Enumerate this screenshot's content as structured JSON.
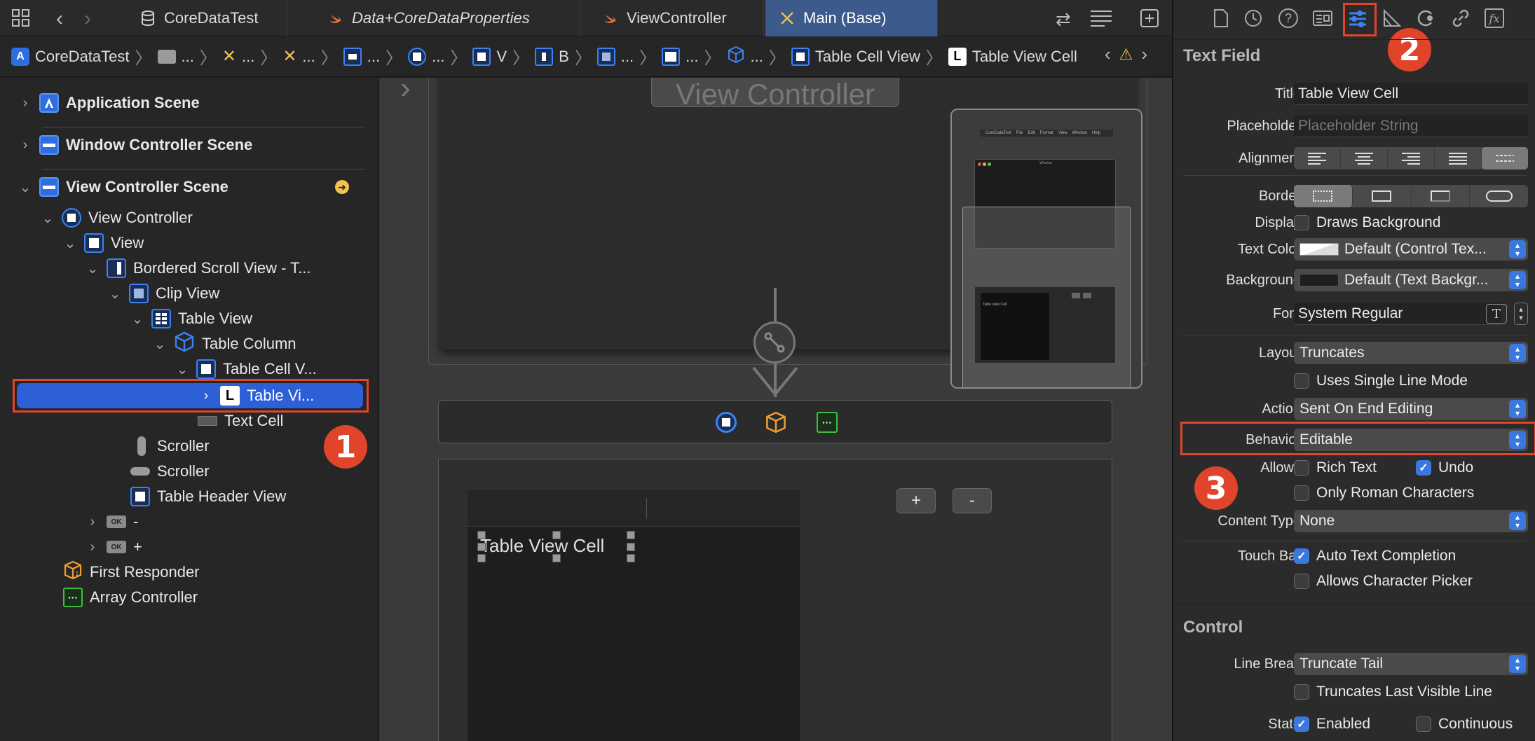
{
  "tabs": [
    {
      "label": "CoreDataTest",
      "icon": "database-icon"
    },
    {
      "label": "Data+CoreDataProperties",
      "icon": "swift-icon"
    },
    {
      "label": "ViewController",
      "icon": "swift-icon"
    },
    {
      "label": "Main (Base)",
      "icon": "storyboard-icon"
    }
  ],
  "breadcrumb": {
    "project": "CoreDataTest",
    "items": [
      "...",
      "...",
      "...",
      "...",
      "...",
      "V",
      "B",
      "...",
      "...",
      "...",
      "Table Cell View",
      "Table View Cell"
    ]
  },
  "outline": {
    "scenes": [
      {
        "label": "Application Scene"
      },
      {
        "label": "Window Controller Scene"
      },
      {
        "label": "View Controller Scene"
      }
    ],
    "tree": [
      {
        "label": "View Controller"
      },
      {
        "label": "View"
      },
      {
        "label": "Bordered Scroll View - T..."
      },
      {
        "label": "Clip View"
      },
      {
        "label": "Table View"
      },
      {
        "label": "Table Column"
      },
      {
        "label": "Table Cell V..."
      },
      {
        "label": "Table Vi..."
      },
      {
        "label": "Text Cell"
      },
      {
        "label": "Scroller"
      },
      {
        "label": "Scroller"
      },
      {
        "label": "Table Header View"
      },
      {
        "label": "-"
      },
      {
        "label": "+"
      },
      {
        "label": "First Responder"
      },
      {
        "label": "Array Controller"
      }
    ],
    "ok_badge": "OK"
  },
  "canvas": {
    "vc_title": "View Controller",
    "cell_text": "Table View Cell",
    "plus_label": "+",
    "minus_label": "-",
    "mini_cell_text": "Table View Cell",
    "mini_menu": [
      "CoreDataTest",
      "File",
      "Edit",
      "Format",
      "View",
      "Window",
      "Help"
    ],
    "mini_window_title": "Window"
  },
  "annotations": {
    "one": "1",
    "two": "2",
    "three": "3"
  },
  "inspector": {
    "tab_icons": [
      "file-icon",
      "history-icon",
      "help-icon",
      "identity-icon",
      "attributes-icon",
      "size-icon",
      "connections-icon",
      "bindings-icon",
      "effects-icon"
    ],
    "section_text_field": "Text Field",
    "title_label": "Title",
    "title_value": "Table View Cell",
    "placeholder_label": "Placeholder",
    "placeholder_value": "Placeholder String",
    "alignment_label": "Alignment",
    "border_label": "Border",
    "display_label": "Display",
    "draws_background": "Draws Background",
    "text_color_label": "Text Color",
    "text_color_value": "Default (Control Tex...",
    "background_label": "Background",
    "background_value": "Default (Text Backgr...",
    "font_label": "Font",
    "font_value": "System Regular",
    "layout_label": "Layout",
    "layout_value": "Truncates",
    "single_line": "Uses Single Line Mode",
    "action_label": "Action",
    "action_value": "Sent On End Editing",
    "behavior_label": "Behavior",
    "behavior_value": "Editable",
    "allows_label": "Allows",
    "rich_text": "Rich Text",
    "undo": "Undo",
    "roman_chars": "Only Roman Characters",
    "content_type_label": "Content Type",
    "content_type_value": "None",
    "touch_bar_label": "Touch Bar",
    "auto_completion": "Auto Text Completion",
    "char_picker": "Allows Character Picker",
    "section_control": "Control",
    "line_break_label": "Line Break",
    "line_break_value": "Truncate Tail",
    "truncates_last": "Truncates Last Visible Line",
    "state_label": "State",
    "enabled": "Enabled",
    "continuous": "Continuous"
  }
}
